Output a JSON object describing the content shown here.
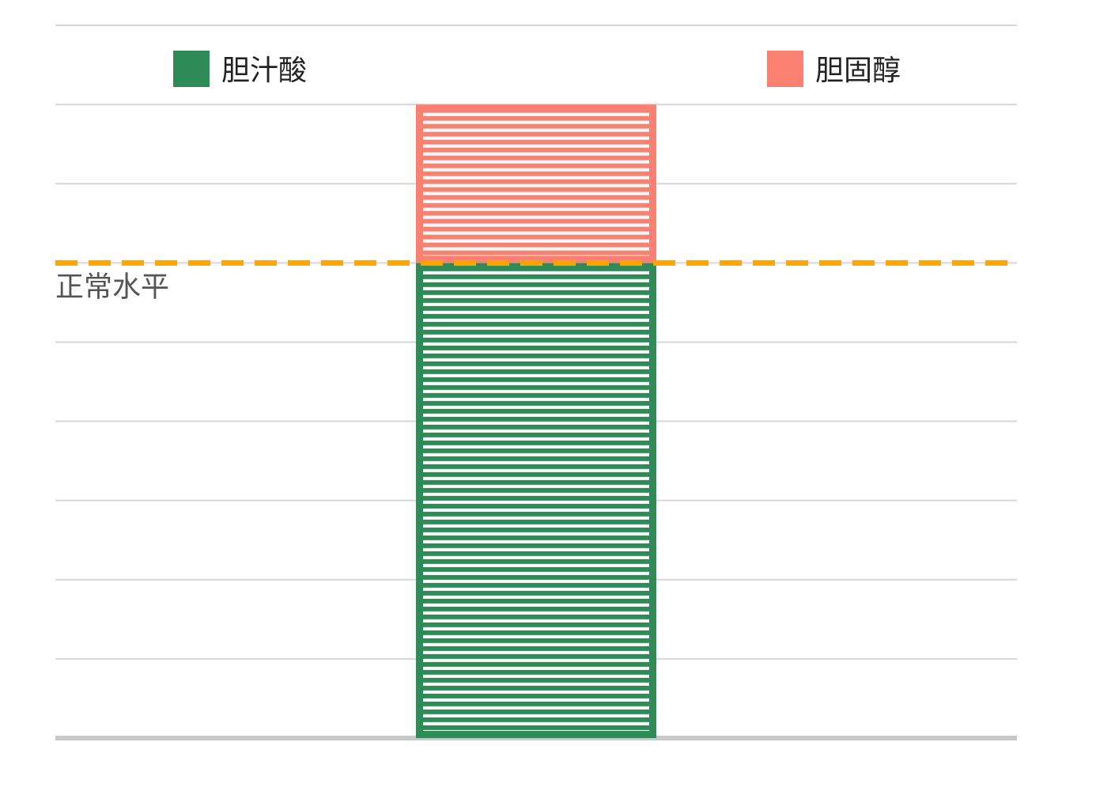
{
  "chart_data": {
    "type": "bar",
    "stacked": true,
    "categories": [
      ""
    ],
    "series": [
      {
        "name": "胆汁酸",
        "values": [
          6
        ],
        "color": "#2e8b57"
      },
      {
        "name": "胆固醇",
        "values": [
          2
        ],
        "color": "#fa8072"
      }
    ],
    "reference_line": {
      "label": "正常水平",
      "value": 6,
      "color": "#ffa500",
      "style": "dashed"
    },
    "ylim": [
      0,
      9
    ],
    "grid": true,
    "legend": "top",
    "bar_fill": "horizontal-stripes",
    "title": "",
    "xlabel": "",
    "ylabel": ""
  }
}
